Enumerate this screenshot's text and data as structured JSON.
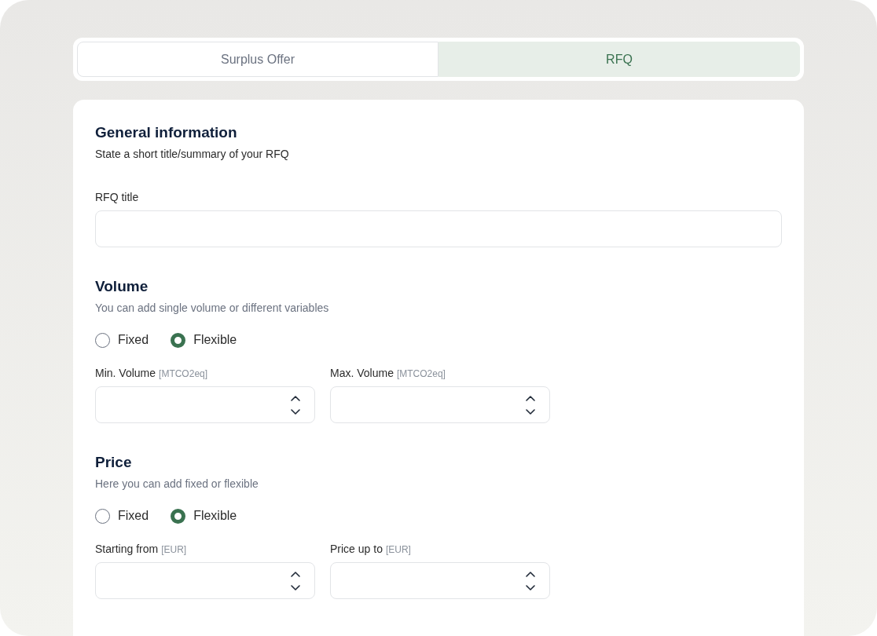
{
  "tabs": [
    {
      "label": "Surplus Offer",
      "selected": false
    },
    {
      "label": "RFQ",
      "selected": true
    }
  ],
  "sections": [
    {
      "kind": "text",
      "title": "General information",
      "subtitle": "State a short title/summary of your RFQ",
      "fields": [
        {
          "label": "RFQ title"
        }
      ]
    },
    {
      "kind": "range",
      "title": "Volume",
      "subtitle": "You can add single volume or different variables",
      "options": [
        {
          "label": "Fixed",
          "selected": false
        },
        {
          "label": "Flexible",
          "selected": true
        }
      ],
      "fields": [
        {
          "label": "Min. Volume",
          "unit": "[MTCO2eq]"
        },
        {
          "label": "Max. Volume",
          "unit": "[MTCO2eq]"
        }
      ]
    },
    {
      "kind": "range",
      "title": "Price",
      "subtitle": "Here you can add fixed or flexible",
      "options": [
        {
          "label": "Fixed",
          "selected": false
        },
        {
          "label": "Flexible",
          "selected": true
        }
      ],
      "fields": [
        {
          "label": "Starting from",
          "unit": "[EUR]"
        },
        {
          "label": "Price up to",
          "unit": "[EUR]"
        }
      ]
    }
  ]
}
